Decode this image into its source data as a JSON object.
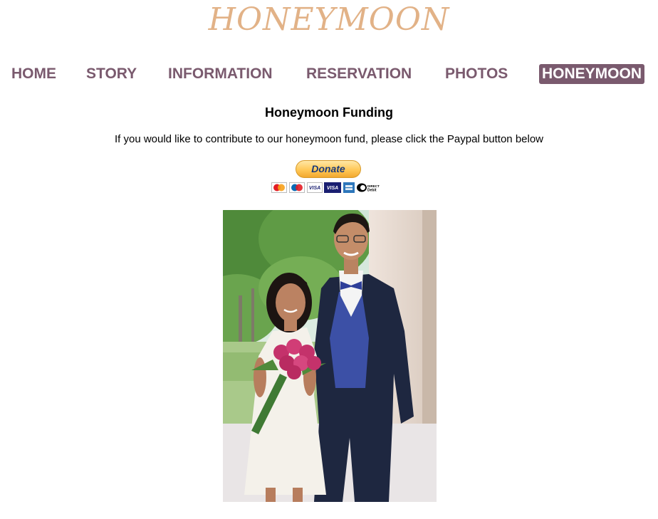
{
  "site": {
    "title": "HONEYMOON"
  },
  "nav": {
    "items": [
      {
        "label": "HOME"
      },
      {
        "label": "STORY"
      },
      {
        "label": "INFORMATION"
      },
      {
        "label": "RESERVATION"
      },
      {
        "label": "PHOTOS"
      },
      {
        "label": "HONEYMOON",
        "active": true
      }
    ]
  },
  "main": {
    "heading": "Honeymoon Funding",
    "intro": "If you would like to contribute to our honeymoon fund, please click the Paypal button below",
    "donate_label": "Donate",
    "card_logos": [
      "mastercard-icon",
      "maestro-icon",
      "visa-icon",
      "visa-electron-icon",
      "amex-icon",
      "direct-debit-icon"
    ],
    "card_texts": {
      "direct_debit": "DIRECT Debit"
    }
  },
  "colors": {
    "title": "#e2b287",
    "nav": "#7a5a6e",
    "nav_active_bg": "#7a5a6e",
    "nav_active_text": "#ffffff",
    "donate_bg": "#ffc857",
    "donate_text": "#1a3a7a"
  }
}
